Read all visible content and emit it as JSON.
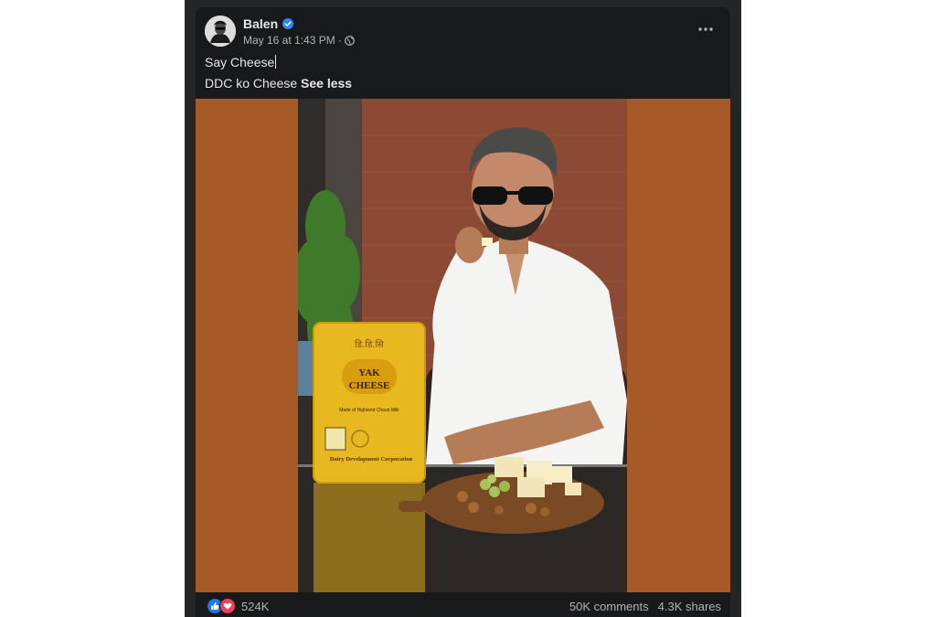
{
  "post": {
    "author": "Balen",
    "timestamp": "May 16 at 1:43 PM",
    "separator": "·",
    "caption_line1": "Say Cheese",
    "caption_line2": "DDC ko Cheese",
    "see_less": "See less"
  },
  "photo": {
    "box_brand_nepali": "डि.डि.सि",
    "box_title_line1": "YAK",
    "box_title_line2": "CHEESE",
    "box_subtitle": "Made of Highland Chauri Milk",
    "box_maker": "Dairy Development Corporation"
  },
  "footer": {
    "reactions_count": "524K",
    "comments": "50K comments",
    "shares": "4.3K shares"
  },
  "colors": {
    "card_bg": "#18191a",
    "border_bg": "#242526",
    "media_bg": "#a55a27",
    "text_primary": "#e4e6eb",
    "text_secondary": "#b0b3b8",
    "verified_blue": "#2d88ff",
    "like_blue": "#1877f2",
    "love_red": "#f33e58",
    "cheese_yellow": "#e8b820"
  },
  "icons": [
    "verified-badge-icon",
    "globe-icon",
    "more-options-icon",
    "like-reaction-icon",
    "love-reaction-icon"
  ]
}
